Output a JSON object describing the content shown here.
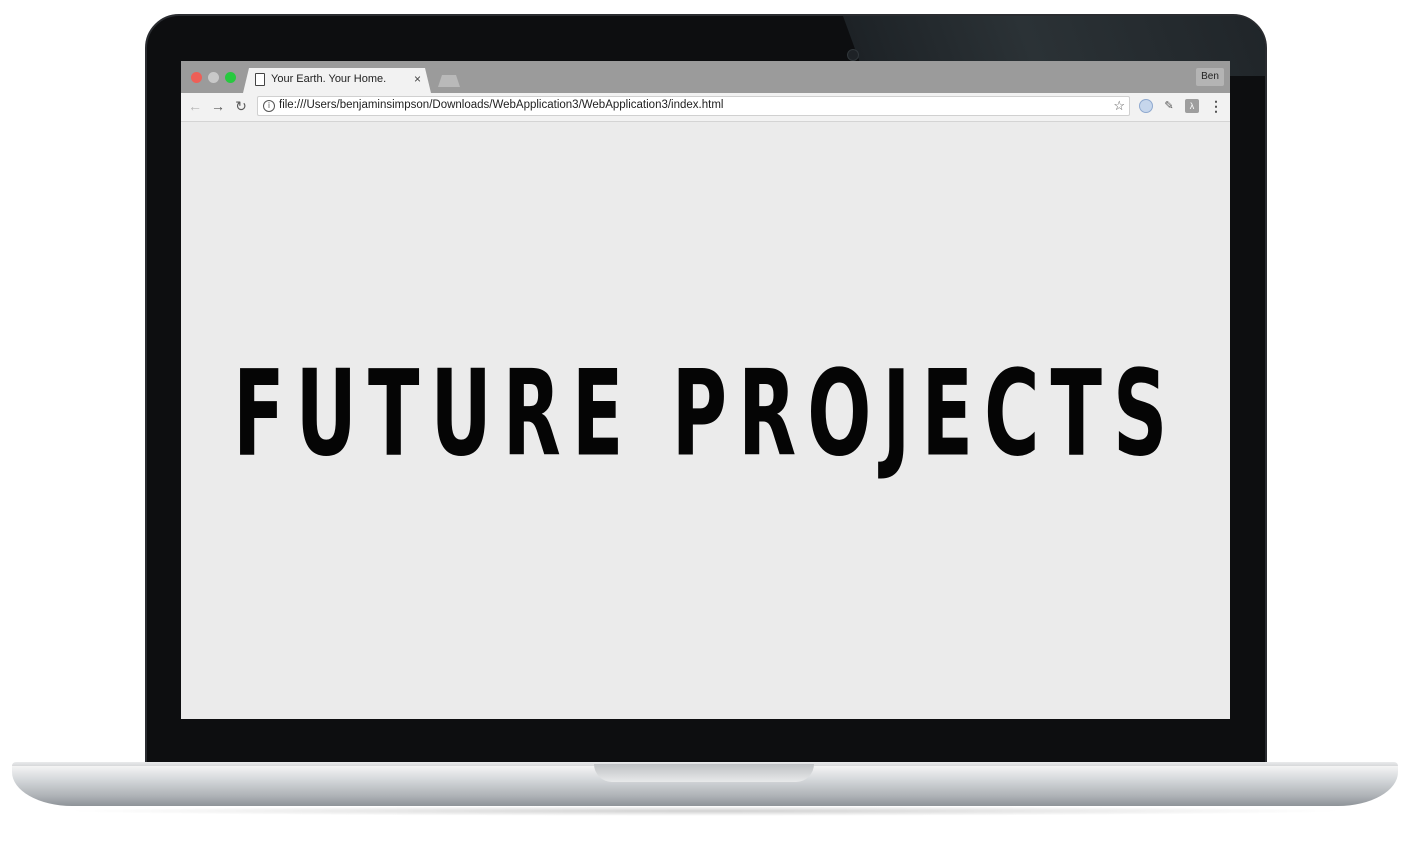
{
  "browser": {
    "tab": {
      "title": "Your Earth. Your Home.",
      "close_glyph": "×"
    },
    "profile_label": "Ben",
    "toolbar": {
      "back_glyph": "←",
      "forward_glyph": "→",
      "reload_glyph": "↻",
      "info_glyph": "i",
      "url": "file:///Users/benjaminsimpson/Downloads/WebApplication3/WebApplication3/index.html",
      "bookmark_glyph": "☆",
      "extension_2_glyph": "✎",
      "extension_3_glyph": "λ",
      "menu_glyph": "⋮"
    }
  },
  "page": {
    "headline": "FUTURE PROJECTS"
  },
  "icons": {
    "traffic_close": "close-dot",
    "traffic_minimize": "minimize-dot",
    "traffic_maximize": "maximize-dot",
    "tab_page": "document-icon",
    "extension_1": "extension-icon",
    "extension_2": "eyedropper-icon",
    "extension_3": "extension-icon"
  },
  "colors": {
    "page_background": "#ebebeb",
    "headline": "#050505",
    "tabstrip": "#9b9b9b",
    "toolbar": "#f2f2f2"
  }
}
